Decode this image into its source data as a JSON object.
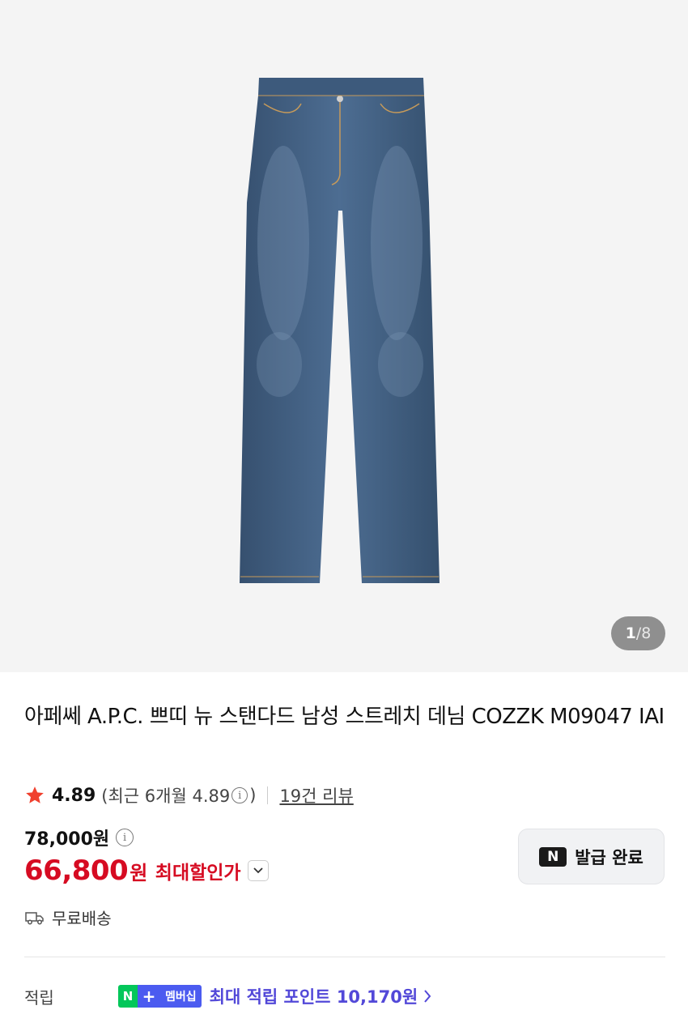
{
  "gallery": {
    "counter_current": "1",
    "counter_separator": "/",
    "counter_total": "8"
  },
  "product": {
    "title": "아페쎄 A.P.C. 쁘띠 뉴 스탠다드 남성 스트레치 데님 COZZK M09047 IAI"
  },
  "rating": {
    "score": "4.89",
    "recent_prefix": "(최근 6개월 4.89",
    "recent_suffix": ")",
    "reviews": "19건 리뷰"
  },
  "price": {
    "original": "78,000원",
    "sale_amount": "66,800",
    "sale_unit": "원",
    "sale_label": "최대할인가"
  },
  "coupon": {
    "logo": "N",
    "label": "발급 완료"
  },
  "shipping": {
    "label": "무료배송"
  },
  "points": {
    "label": "적립",
    "badge_n": "N",
    "badge_plus": "+",
    "badge_text": "멤버십",
    "text": "최대 적립 포인트 10,170원"
  },
  "colors": {
    "sale_red": "#d60b22",
    "star_red": "#f0402e",
    "naver_green": "#03c75a",
    "membership_blue": "#4b5bf0",
    "points_purple": "#5248d8"
  }
}
